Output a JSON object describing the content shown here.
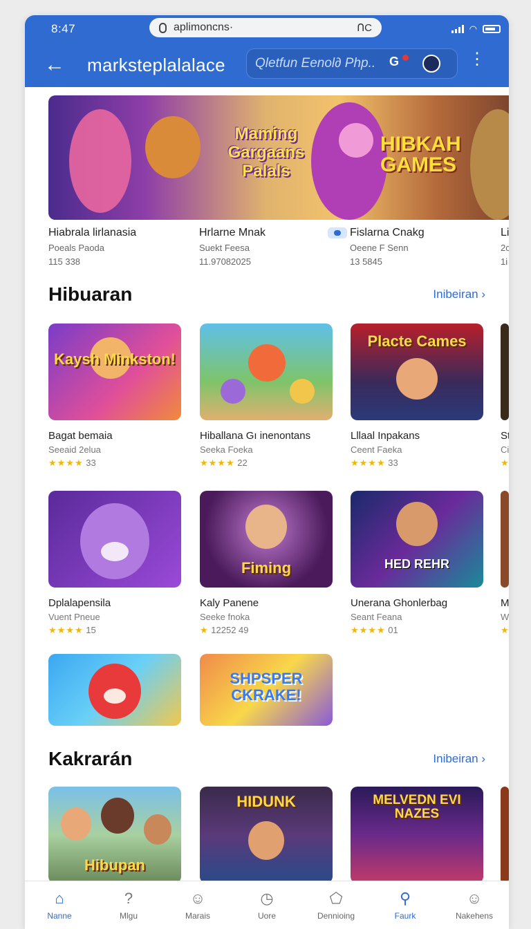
{
  "status": {
    "time": "8:47",
    "url": "aplimoncns·",
    "reload": "ᑎC"
  },
  "appbar": {
    "title": "marksteplalalace",
    "search_placeholder": "Qletfun Eenol∂ Php..",
    "camera_label": "G"
  },
  "hero": {
    "texts": [
      "Maming Gargaans Palals",
      "HIBKAH GAMES"
    ],
    "captions": [
      {
        "title": "Hiabrala lirlanasia",
        "sub": "Poeals Paoda",
        "num": "115 338"
      },
      {
        "title": "Hrlarne Mnak",
        "sub": "Suekt Feesa",
        "num": "11.97082025"
      },
      {
        "title": "Fislarna Cnakg",
        "sub": "Oeene F Senn",
        "num": "13 5845"
      },
      {
        "title": "Li",
        "sub": "2c",
        "num": "1i"
      }
    ]
  },
  "sections": [
    {
      "title": "Hibuaran",
      "more": "Inibeiran ›"
    },
    {
      "title": "Kakrarán",
      "more": "Inibeiran ›"
    }
  ],
  "section1_cards": [
    {
      "label": "Kaysh Minkston!",
      "title": "Bagat bemaia",
      "sub": "Seeaid 2elua",
      "stars": "★★★★",
      "count": "33"
    },
    {
      "label": "",
      "title": "Hiballana Gı inenontans",
      "sub": "Seeka Foeka",
      "stars": "★★★★",
      "count": "22"
    },
    {
      "label": "Placte Cames",
      "title": "Lllaal Inpakans",
      "sub": "Ceent Faeka",
      "stars": "★★★★",
      "count": "33"
    },
    {
      "label": "",
      "title": "St",
      "sub": "Ci",
      "stars": "★",
      "count": ""
    },
    {
      "label": "",
      "title": "Dplalapensila",
      "sub": "Vuent Pneue",
      "stars": "★★★★",
      "count": "15"
    },
    {
      "label": "Fiming",
      "title": "Kaly Panene",
      "sub": "Seeke fnoka",
      "stars": "★",
      "count": "12252 49"
    },
    {
      "label": "HED REHR",
      "title": "Unerana Ghonlerbag",
      "sub": "Seant Feana",
      "stars": "★★★★",
      "count": "01"
    },
    {
      "label": "",
      "title": "M",
      "sub": "W",
      "stars": "★",
      "count": ""
    },
    {
      "label": "",
      "title": "",
      "sub": "",
      "stars": "",
      "count": ""
    },
    {
      "label": "SHPSPER CKRAKE!",
      "title": "",
      "sub": "",
      "stars": "",
      "count": ""
    }
  ],
  "section2_cards": [
    {
      "label": "Hibupan"
    },
    {
      "label": "HIDUNK"
    },
    {
      "label": "MELVEDN EVI NAZES"
    }
  ],
  "bottom_nav": [
    {
      "label": "Nanne",
      "icon": "home-icon"
    },
    {
      "label": "Mlgu",
      "icon": "help-icon"
    },
    {
      "label": "Marais",
      "icon": "person-icon"
    },
    {
      "label": "Uore",
      "icon": "clock-icon"
    },
    {
      "label": "Dennioing",
      "icon": "box-icon"
    },
    {
      "label": "Faurk",
      "icon": "search-icon"
    },
    {
      "label": "Nakehens",
      "icon": "profile-icon"
    }
  ],
  "colors": {
    "brand": "#2f6bd0",
    "star": "#f2b705"
  }
}
